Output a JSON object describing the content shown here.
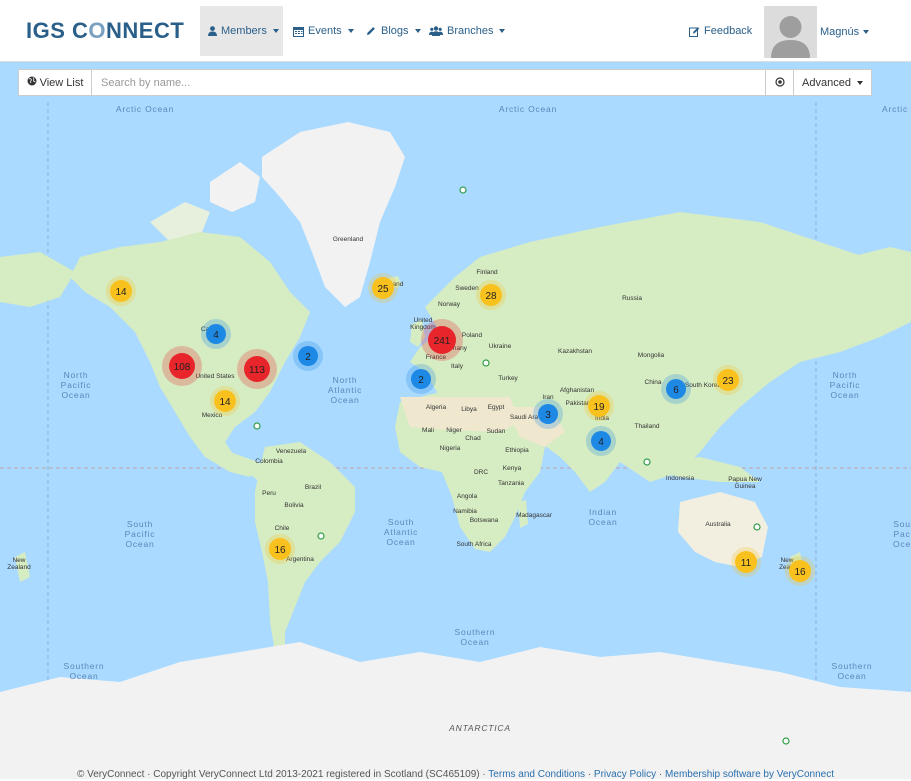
{
  "brand": {
    "logo_pre": "IGS C",
    "logo_o": "O",
    "logo_post": "NNECT"
  },
  "nav": {
    "members": "Members",
    "events": "Events",
    "blogs": "Blogs",
    "branches": "Branches",
    "feedback": "Feedback",
    "user": "Magnús"
  },
  "search": {
    "view_list": "View List",
    "placeholder": "Search by name...",
    "advanced": "Advanced"
  },
  "map": {
    "clusters": [
      {
        "count": "14",
        "level": "medium"
      },
      {
        "count": "4",
        "level": "small"
      },
      {
        "count": "108",
        "level": "large"
      },
      {
        "count": "113",
        "level": "large"
      },
      {
        "count": "2",
        "level": "small"
      },
      {
        "count": "14",
        "level": "medium"
      },
      {
        "count": "25",
        "level": "medium"
      },
      {
        "count": "28",
        "level": "medium"
      },
      {
        "count": "241",
        "level": "large"
      },
      {
        "count": "2",
        "level": "small"
      },
      {
        "count": "3",
        "level": "small"
      },
      {
        "count": "19",
        "level": "medium"
      },
      {
        "count": "4",
        "level": "small"
      },
      {
        "count": "6",
        "level": "small"
      },
      {
        "count": "23",
        "level": "medium"
      },
      {
        "count": "16",
        "level": "medium"
      },
      {
        "count": "11",
        "level": "medium"
      },
      {
        "count": "16",
        "level": "medium"
      }
    ],
    "oceans": {
      "arctic_1": "Arctic Ocean",
      "arctic_2": "Arctic Ocean",
      "arctic_3": "Arctic",
      "north_pacific_1": "North",
      "north_pacific_2": "Pacific",
      "north_pacific_3": "Ocean",
      "north_pacific_r1": "North",
      "north_pacific_r2": "Pacific",
      "north_pacific_r3": "Ocean",
      "north_atlantic_1": "North",
      "north_atlantic_2": "Atlantic",
      "north_atlantic_3": "Ocean",
      "south_pacific_1": "South",
      "south_pacific_2": "Pacific",
      "south_pacific_3": "Ocean",
      "south_pacific_r1": "Sou",
      "south_pacific_r2": "Pac",
      "south_pacific_r3": "Oce",
      "south_atlantic_1": "South",
      "south_atlantic_2": "Atlantic",
      "south_atlantic_3": "Ocean",
      "indian_1": "Indian",
      "indian_2": "Ocean",
      "southern_1": "Southern",
      "southern_2": "Ocean",
      "southern_l1": "Southern",
      "southern_l2": "Ocean",
      "southern_r1": "Southern",
      "southern_r2": "Ocean",
      "antarctica": "ANTARCTICA"
    },
    "places": {
      "greenland": "Greenland",
      "finland": "Finland",
      "sweden": "Sweden",
      "norway": "Norway",
      "russia": "Russia",
      "united_kingdom_1": "United",
      "united_kingdom_2": "Kingdom",
      "poland": "Poland",
      "ukraine": "Ukraine",
      "kazakhstan": "Kazakhstan",
      "mongolia": "Mongolia",
      "france": "France",
      "italy": "Italy",
      "turkey": "Turkey",
      "germany": "many",
      "canada": "Ca",
      "united_states": "United States",
      "mexico": "Mexico",
      "china": "China",
      "south_korea": "South Korea",
      "afghanistan": "Afghanistan",
      "iran": "Iran",
      "pakistan": "Pakistan",
      "india": "India",
      "thailand": "Thailand",
      "saudi_arabia": "Saudi Ara",
      "algeria": "Algeria",
      "libya": "Libya",
      "egypt": "Egypt",
      "mali": "Mali",
      "niger": "Niger",
      "chad": "Chad",
      "sudan": "Sudan",
      "nigeria": "Nigeria",
      "ethiopia": "Ethiopia",
      "kenya": "Kenya",
      "drc": "DRC",
      "tanzania": "Tanzania",
      "angola": "Angola",
      "namibia": "Namibia",
      "botswana": "Botswana",
      "madagascar": "Madagascar",
      "south_africa": "South Africa",
      "venezuela": "Venezuela",
      "colombia": "Colombia",
      "peru": "Peru",
      "brazil": "Brazil",
      "bolivia": "Bolivia",
      "chile": "Chile",
      "argentina": "Argentina",
      "indonesia": "Indonesia",
      "png_1": "Papua New",
      "png_2": "Guinea",
      "australia": "Australia",
      "nz_r1": "New",
      "nz_r2": "Zealan",
      "nz_l1": "New",
      "nz_l2": "Zealand",
      "iceland": "and"
    }
  },
  "footer": {
    "copyright": "© VeryConnect · Copyright VeryConnect Ltd 2013-2021 registered in Scotland (SC465109) · ",
    "terms": "Terms and Conditions",
    "sep1": " · ",
    "privacy": "Privacy Policy",
    "sep2": " · ",
    "membership": "Membership software by VeryConnect"
  },
  "colors": {
    "ocean": "#aadaff",
    "land": "#d6ecc3",
    "ice": "#f2f2f2",
    "cluster_small": "#1e88e5",
    "cluster_medium": "#f9c11e",
    "cluster_large": "#e8252a",
    "brand": "#2a5f8a"
  }
}
